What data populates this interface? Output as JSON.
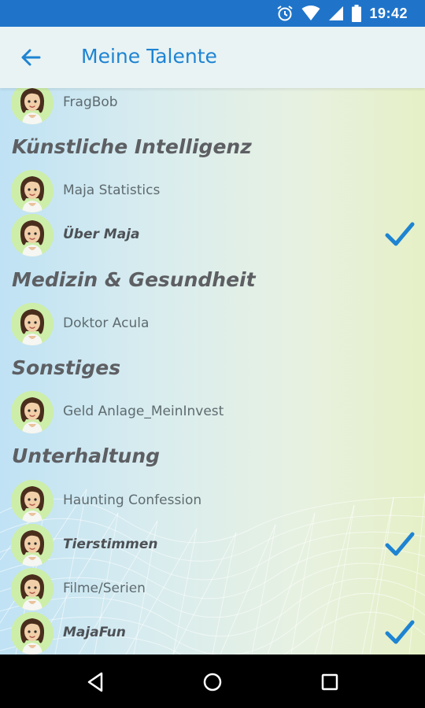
{
  "statusbar": {
    "time": "19:42",
    "icons": [
      "alarm-icon",
      "wifi-icon",
      "signal-icon",
      "battery-icon"
    ]
  },
  "appbar": {
    "title": "Meine Talente",
    "back_icon": "arrow-left-icon"
  },
  "colors": {
    "accent": "#1e84d2",
    "statusbar": "#1f74c9",
    "check": "#1e84d2"
  },
  "list": {
    "first_item": {
      "label": "FragBob",
      "checked": false
    },
    "sections": [
      {
        "title": "Künstliche Intelligenz",
        "items": [
          {
            "label": "Maja Statistics",
            "checked": false
          },
          {
            "label": "Über Maja",
            "checked": true
          }
        ]
      },
      {
        "title": "Medizin & Gesundheit",
        "items": [
          {
            "label": "Doktor Acula",
            "checked": false
          }
        ]
      },
      {
        "title": "Sonstiges",
        "items": [
          {
            "label": "Geld Anlage_MeinInvest",
            "checked": false
          }
        ]
      },
      {
        "title": "Unterhaltung",
        "items": [
          {
            "label": "Haunting Confession",
            "checked": false
          },
          {
            "label": "Tierstimmen",
            "checked": true
          },
          {
            "label": "Filme/Serien",
            "checked": false
          },
          {
            "label": "MajaFun",
            "checked": true
          }
        ]
      }
    ]
  },
  "navbar": {
    "buttons": [
      "back-triangle-icon",
      "home-circle-icon",
      "recents-square-icon"
    ]
  }
}
